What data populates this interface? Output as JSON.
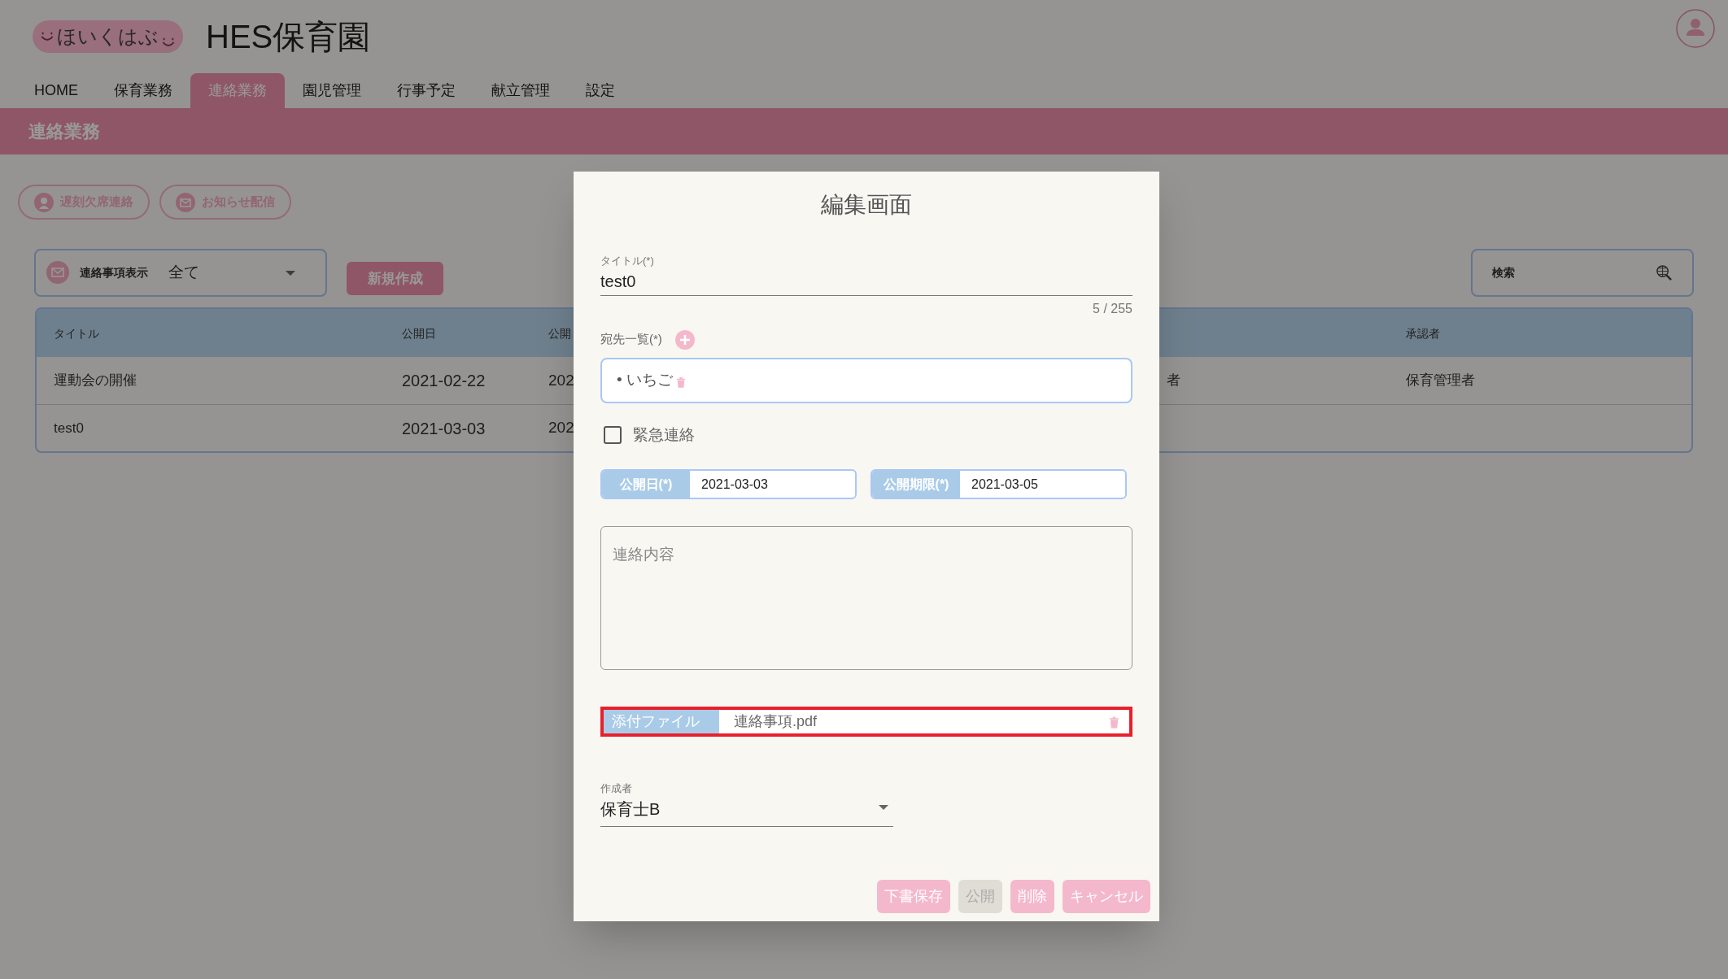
{
  "logo": {
    "text": "ほいくはぶ"
  },
  "app_title": "HES保育園",
  "nav_tabs": [
    {
      "label": "HOME",
      "selected": false
    },
    {
      "label": "保育業務",
      "selected": false
    },
    {
      "label": "連絡業務",
      "selected": true
    },
    {
      "label": "園児管理",
      "selected": false
    },
    {
      "label": "行事予定",
      "selected": false
    },
    {
      "label": "献立管理",
      "selected": false
    },
    {
      "label": "設定",
      "selected": false
    }
  ],
  "page_header": "連絡業務",
  "action_buttons": [
    {
      "label": "遅刻欠席連絡",
      "kind": "person"
    },
    {
      "label": "お知らせ配信",
      "kind": "mail"
    }
  ],
  "filter": {
    "label": "連絡事項表示",
    "value": "全て"
  },
  "new_button": "新規作成",
  "search": {
    "placeholder": "検索"
  },
  "table": {
    "columns": [
      {
        "label": "タイトル"
      },
      {
        "label": "公開日"
      },
      {
        "label": "公開"
      },
      {},
      {
        "label": "承認者"
      }
    ],
    "rows": [
      {
        "cells": [
          "運動会の開催",
          "2021-02-22",
          "202",
          "者",
          "保育管理者"
        ]
      },
      {
        "cells": [
          "test0",
          "2021-03-03",
          "202"
        ]
      }
    ]
  },
  "dialog": {
    "title": "編集画面",
    "title_field": {
      "label": "タイトル(*)",
      "value": "test0",
      "counter": "5 / 255"
    },
    "recipients": {
      "label": "宛先一覧(*)",
      "items": [
        "• いちご"
      ]
    },
    "urgent": {
      "label": "緊急連絡",
      "checked": false
    },
    "dates": [
      {
        "label": "公開日(*)",
        "value": "2021-03-03"
      },
      {
        "label": "公開期限(*)",
        "value": "2021-03-05"
      }
    ],
    "content": {
      "placeholder": "連絡内容"
    },
    "attachment": {
      "label": "添付ファイル",
      "file": "連絡事項.pdf",
      "highlighted": true
    },
    "author": {
      "label": "作成者",
      "value": "保育士B"
    },
    "buttons": [
      {
        "label": "下書保存",
        "disabled": false
      },
      {
        "label": "公開",
        "disabled": true
      },
      {
        "label": "削除",
        "disabled": false
      },
      {
        "label": "キャンセル",
        "disabled": false
      }
    ]
  }
}
